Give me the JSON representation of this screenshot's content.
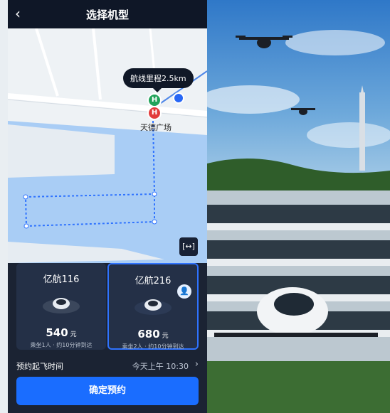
{
  "header": {
    "back_icon": "chevron-left-icon",
    "back_glyph": "‹",
    "title": "选择机型"
  },
  "map": {
    "route_bubble": "航线里程2.5km",
    "pin_green": "H",
    "pin_red": "H",
    "place_label": "天德广场",
    "expand_label": "[↔]"
  },
  "cards": [
    {
      "name": "亿航116",
      "price": "540",
      "unit": "元",
      "note": "乘坐1人 · 约10分钟到达",
      "selected": false
    },
    {
      "name": "亿航216",
      "price": "680",
      "unit": "元",
      "note": "乘坐2人 · 约10分钟到达",
      "selected": true,
      "badge_icon": "person-badge-icon",
      "badge_glyph": "👤"
    }
  ],
  "booking": {
    "label": "预约起飞时间",
    "value": "今天上午 10:30",
    "chevron": "›"
  },
  "confirm_button": "确定预约",
  "colors": {
    "accent": "#1a6dff",
    "dark": "#1b2333"
  }
}
